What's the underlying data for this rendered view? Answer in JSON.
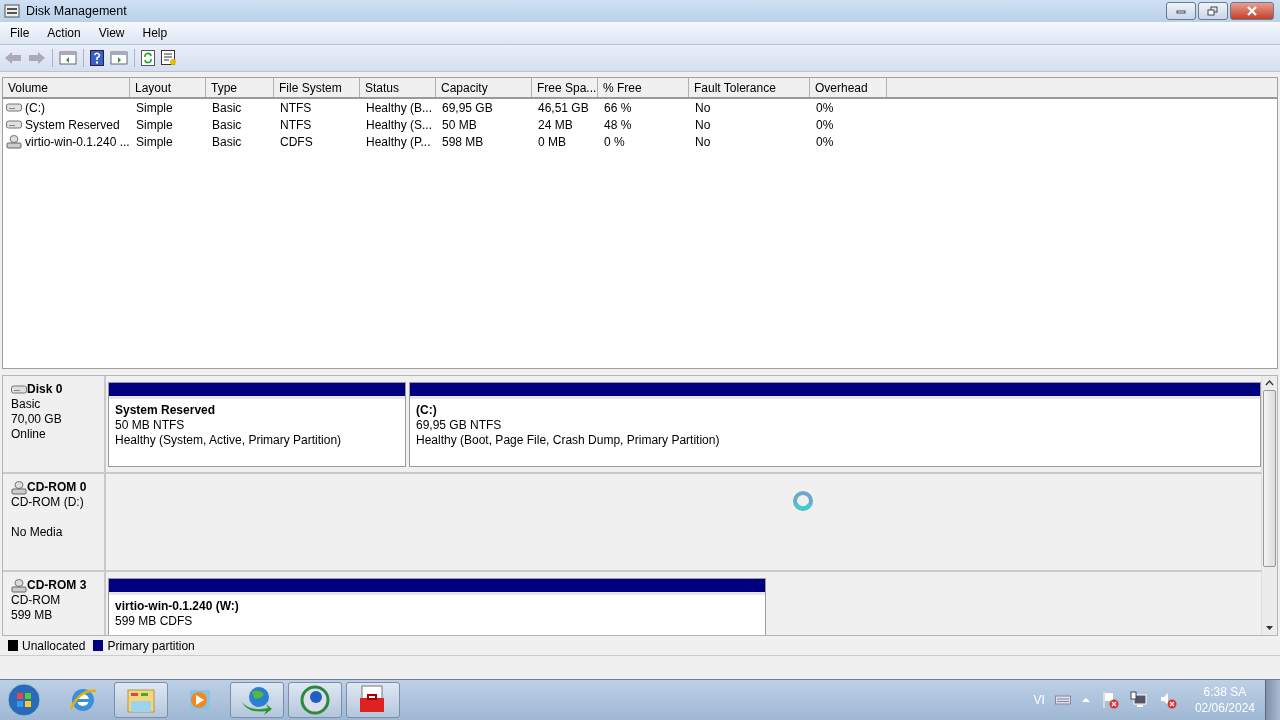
{
  "window": {
    "title": "Disk Management"
  },
  "menu": [
    "File",
    "Action",
    "View",
    "Help"
  ],
  "volumes": {
    "columns": [
      "Volume",
      "Layout",
      "Type",
      "File System",
      "Status",
      "Capacity",
      "Free Spa...",
      "% Free",
      "Fault Tolerance",
      "Overhead"
    ],
    "rows": [
      {
        "kind": "disk",
        "cells": [
          "(C:)",
          "Simple",
          "Basic",
          "NTFS",
          "Healthy (B...",
          "69,95 GB",
          "46,51 GB",
          "66 %",
          "No",
          "0%"
        ]
      },
      {
        "kind": "disk",
        "cells": [
          "System Reserved",
          "Simple",
          "Basic",
          "NTFS",
          "Healthy (S...",
          "50 MB",
          "24 MB",
          "48 %",
          "No",
          "0%"
        ]
      },
      {
        "kind": "cd",
        "cells": [
          "virtio-win-0.1.240 ...",
          "Simple",
          "Basic",
          "CDFS",
          "Healthy (P...",
          "598 MB",
          "0 MB",
          "0 %",
          "No",
          "0%"
        ]
      }
    ]
  },
  "disks": [
    {
      "kind": "disk",
      "name": "Disk 0",
      "lines": [
        "Basic",
        "70,00 GB",
        "Online"
      ],
      "partitions": [
        {
          "name": "System Reserved",
          "size": "50 MB NTFS",
          "status": "Healthy (System, Active, Primary Partition)"
        },
        {
          "name": "(C:)",
          "size": "69,95 GB NTFS",
          "status": "Healthy (Boot, Page File, Crash Dump, Primary Partition)"
        }
      ]
    },
    {
      "kind": "cd",
      "name": "CD-ROM 0",
      "lines": [
        "CD-ROM (D:)",
        "No Media"
      ]
    },
    {
      "kind": "cd",
      "name": "CD-ROM 3",
      "lines": [
        "CD-ROM",
        "599 MB"
      ],
      "partitions": [
        {
          "name": "virtio-win-0.1.240  (W:)",
          "size": "599 MB CDFS"
        }
      ]
    }
  ],
  "legend": [
    {
      "label": "Unallocated",
      "color": "#000000"
    },
    {
      "label": "Primary partition",
      "color": "#000080"
    }
  ],
  "taskbar": {
    "apps": [
      {
        "kind": "browser-e",
        "running": false
      },
      {
        "kind": "folder",
        "running": true
      },
      {
        "kind": "player",
        "running": false
      },
      {
        "kind": "globe-arrow",
        "running": true
      },
      {
        "kind": "globe",
        "running": true
      },
      {
        "kind": "toolbox",
        "running": true
      }
    ],
    "language": "VI",
    "time": "6:38 SA",
    "date": "02/06/2024"
  }
}
